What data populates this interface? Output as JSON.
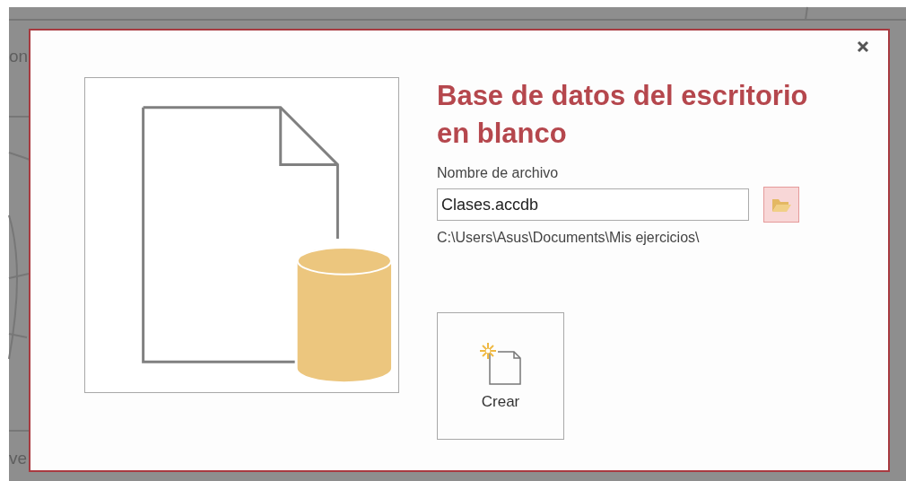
{
  "background": {
    "texts": [
      "on",
      "ve"
    ]
  },
  "dialog": {
    "title": "Base de datos del escritorio en blanco",
    "file_name_label": "Nombre de archivo",
    "file_name_value": "Clases.accdb",
    "path": "C:\\Users\\Asus\\Documents\\Mis ejercicios\\",
    "create_button": "Crear",
    "browse_selected": true
  }
}
